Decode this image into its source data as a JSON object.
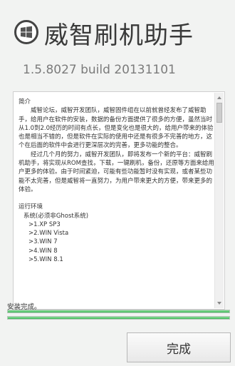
{
  "header": {
    "app_title": "威智刷机助手",
    "version": "1.5.8027 build 20131101"
  },
  "intro": {
    "heading": "简介",
    "para1": "威智论坛，威智开发团队，威智固件组在以前就曾经发布了威智助手，给用户在软件的安装，数据的备份方面提供了很多的方便，虽然当时从1.0到2.0经历的时间有点长，但是变化也是很大的，给用户带来的体验也是相当不错的，但是软件在实际的使用中还是有很多不完善的地方，这个在后面的软件中会进行更深层次的完善，更多功能的整合。",
    "para2": "经过几个月的努力，威智开发团队，即将发布一个新的平台：威智刷机助手，将实现从ROM查找，下载，一键刷机，备份，还原等方面来给用户更多的体验。由于时间紧迫，可能有些功能暂时没有实现，或者某些功能不太完善，但是威智将一直努力，为用户带来更大的方便，带来更多的体验。"
  },
  "requirements": {
    "heading": "运行环境",
    "system_line": "系统(必须非Ghost系统)",
    "os_list": [
      ">1.XP SP3",
      ">2.WIN Vista",
      ">3.WIN 7",
      ">4.WIN 8",
      ">5.WIN 8.1"
    ]
  },
  "status": {
    "text": "安装完成。",
    "progress1": 1.0,
    "progress2": 1.0
  },
  "buttons": {
    "finish_label": "完成"
  },
  "colors": {
    "progress_fill": "#3fb65a",
    "background": "#f2f3f2"
  },
  "icons": {
    "logo": "windows-logo-icon"
  }
}
